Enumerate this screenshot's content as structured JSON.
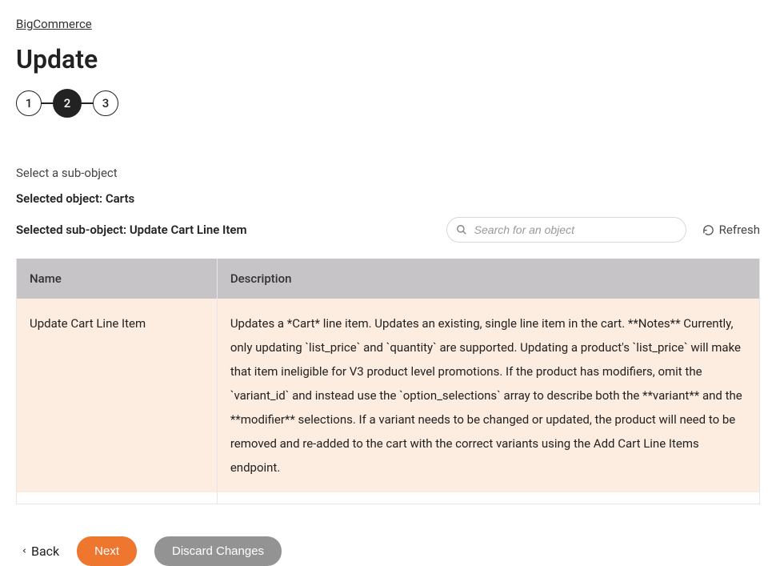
{
  "breadcrumb": {
    "label": "BigCommerce"
  },
  "page": {
    "title": "Update"
  },
  "stepper": {
    "steps": [
      "1",
      "2",
      "3"
    ],
    "active_index": 1
  },
  "section": {
    "label": "Select a sub-object"
  },
  "selected_object": {
    "label": "Selected object: ",
    "value": "Carts"
  },
  "selected_sub_object": {
    "label": "Selected sub-object: ",
    "value": "Update Cart Line Item"
  },
  "search": {
    "placeholder": "Search for an object"
  },
  "refresh": {
    "label": "Refresh"
  },
  "table": {
    "headers": {
      "name": "Name",
      "description": "Description"
    },
    "rows": [
      {
        "name": "Update Cart Line Item",
        "description": "Updates a *Cart* line item. Updates an existing, single line item in the cart. **Notes** Currently, only updating `list_price` and `quantity` are supported. Updating a product's `list_price` will make that item ineligible for V3 product level promotions. If the product has modifiers, omit the `variant_id` and instead use the `option_selections` array to describe both the **variant** and the **modifier** selections. If a variant needs to be changed or updated, the product will need to be removed and re-added to the cart with the correct variants using the Add Cart Line Items endpoint."
      }
    ]
  },
  "actions": {
    "back": "Back",
    "next": "Next",
    "discard": "Discard Changes"
  }
}
